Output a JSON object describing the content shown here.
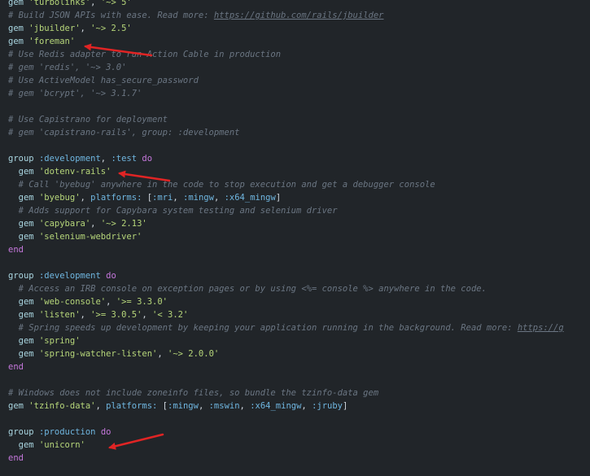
{
  "editor": {
    "lines": [
      [
        {
          "t": "gem",
          "c": "gem"
        },
        {
          "t": " ",
          "c": "plain"
        },
        {
          "t": "'turbolinks'",
          "c": "str"
        },
        {
          "t": ", ",
          "c": "plain"
        },
        {
          "t": "'~> 5'",
          "c": "str"
        }
      ],
      [
        {
          "t": "# Build JSON APIs with ease. Read more: ",
          "c": "cmt"
        },
        {
          "t": "https://github.com/rails/jbuilder",
          "c": "url"
        }
      ],
      [
        {
          "t": "gem",
          "c": "gem"
        },
        {
          "t": " ",
          "c": "plain"
        },
        {
          "t": "'jbuilder'",
          "c": "str"
        },
        {
          "t": ", ",
          "c": "plain"
        },
        {
          "t": "'~> 2.5'",
          "c": "str"
        }
      ],
      [
        {
          "t": "gem",
          "c": "gem"
        },
        {
          "t": " ",
          "c": "plain"
        },
        {
          "t": "'foreman'",
          "c": "str"
        }
      ],
      [
        {
          "t": "# Use Redis adapter to run Action Cable in production",
          "c": "cmt"
        }
      ],
      [
        {
          "t": "# gem 'redis', '~> 3.0'",
          "c": "cmt"
        }
      ],
      [
        {
          "t": "# Use ActiveModel has_secure_password",
          "c": "cmt"
        }
      ],
      [
        {
          "t": "# gem 'bcrypt', '~> 3.1.7'",
          "c": "cmt"
        }
      ],
      [],
      [
        {
          "t": "# Use Capistrano for deployment",
          "c": "cmt"
        }
      ],
      [
        {
          "t": "# gem 'capistrano-rails', group: :development",
          "c": "cmt"
        }
      ],
      [],
      [
        {
          "t": "group",
          "c": "gem"
        },
        {
          "t": " ",
          "c": "plain"
        },
        {
          "t": ":development",
          "c": "sym"
        },
        {
          "t": ", ",
          "c": "plain"
        },
        {
          "t": ":test",
          "c": "sym"
        },
        {
          "t": " ",
          "c": "plain"
        },
        {
          "t": "do",
          "c": "kw"
        }
      ],
      [
        {
          "t": "  gem",
          "c": "gem"
        },
        {
          "t": " ",
          "c": "plain"
        },
        {
          "t": "'dotenv-rails'",
          "c": "str"
        }
      ],
      [
        {
          "t": "  # Call 'byebug' anywhere in the code to stop execution and get a debugger console",
          "c": "cmt"
        }
      ],
      [
        {
          "t": "  gem",
          "c": "gem"
        },
        {
          "t": " ",
          "c": "plain"
        },
        {
          "t": "'byebug'",
          "c": "str"
        },
        {
          "t": ", ",
          "c": "plain"
        },
        {
          "t": "platforms:",
          "c": "sym"
        },
        {
          "t": " [",
          "c": "plain"
        },
        {
          "t": ":mri",
          "c": "sym"
        },
        {
          "t": ", ",
          "c": "plain"
        },
        {
          "t": ":mingw",
          "c": "sym"
        },
        {
          "t": ", ",
          "c": "plain"
        },
        {
          "t": ":x64_mingw",
          "c": "sym"
        },
        {
          "t": "]",
          "c": "plain"
        }
      ],
      [
        {
          "t": "  # Adds support for Capybara system testing and selenium driver",
          "c": "cmt"
        }
      ],
      [
        {
          "t": "  gem",
          "c": "gem"
        },
        {
          "t": " ",
          "c": "plain"
        },
        {
          "t": "'capybara'",
          "c": "str"
        },
        {
          "t": ", ",
          "c": "plain"
        },
        {
          "t": "'~> 2.13'",
          "c": "str"
        }
      ],
      [
        {
          "t": "  gem",
          "c": "gem"
        },
        {
          "t": " ",
          "c": "plain"
        },
        {
          "t": "'selenium-webdriver'",
          "c": "str"
        }
      ],
      [
        {
          "t": "end",
          "c": "kw"
        }
      ],
      [],
      [
        {
          "t": "group",
          "c": "gem"
        },
        {
          "t": " ",
          "c": "plain"
        },
        {
          "t": ":development",
          "c": "sym"
        },
        {
          "t": " ",
          "c": "plain"
        },
        {
          "t": "do",
          "c": "kw"
        }
      ],
      [
        {
          "t": "  # Access an IRB console on exception pages or by using <%= console %> anywhere in the code.",
          "c": "cmt"
        }
      ],
      [
        {
          "t": "  gem",
          "c": "gem"
        },
        {
          "t": " ",
          "c": "plain"
        },
        {
          "t": "'web-console'",
          "c": "str"
        },
        {
          "t": ", ",
          "c": "plain"
        },
        {
          "t": "'>= 3.3.0'",
          "c": "str"
        }
      ],
      [
        {
          "t": "  gem",
          "c": "gem"
        },
        {
          "t": " ",
          "c": "plain"
        },
        {
          "t": "'listen'",
          "c": "str"
        },
        {
          "t": ", ",
          "c": "plain"
        },
        {
          "t": "'>= 3.0.5'",
          "c": "str"
        },
        {
          "t": ", ",
          "c": "plain"
        },
        {
          "t": "'< 3.2'",
          "c": "str"
        }
      ],
      [
        {
          "t": "  # Spring speeds up development by keeping your application running in the background. Read more: ",
          "c": "cmt"
        },
        {
          "t": "https://g",
          "c": "url"
        }
      ],
      [
        {
          "t": "  gem",
          "c": "gem"
        },
        {
          "t": " ",
          "c": "plain"
        },
        {
          "t": "'spring'",
          "c": "str"
        }
      ],
      [
        {
          "t": "  gem",
          "c": "gem"
        },
        {
          "t": " ",
          "c": "plain"
        },
        {
          "t": "'spring-watcher-listen'",
          "c": "str"
        },
        {
          "t": ", ",
          "c": "plain"
        },
        {
          "t": "'~> 2.0.0'",
          "c": "str"
        }
      ],
      [
        {
          "t": "end",
          "c": "kw"
        }
      ],
      [],
      [
        {
          "t": "# Windows does not include zoneinfo files, so bundle the tzinfo-data gem",
          "c": "cmt"
        }
      ],
      [
        {
          "t": "gem",
          "c": "gem"
        },
        {
          "t": " ",
          "c": "plain"
        },
        {
          "t": "'tzinfo-data'",
          "c": "str"
        },
        {
          "t": ", ",
          "c": "plain"
        },
        {
          "t": "platforms:",
          "c": "sym"
        },
        {
          "t": " [",
          "c": "plain"
        },
        {
          "t": ":mingw",
          "c": "sym"
        },
        {
          "t": ", ",
          "c": "plain"
        },
        {
          "t": ":mswin",
          "c": "sym"
        },
        {
          "t": ", ",
          "c": "plain"
        },
        {
          "t": ":x64_mingw",
          "c": "sym"
        },
        {
          "t": ", ",
          "c": "plain"
        },
        {
          "t": ":jruby",
          "c": "sym"
        },
        {
          "t": "]",
          "c": "plain"
        }
      ],
      [],
      [
        {
          "t": "group",
          "c": "gem"
        },
        {
          "t": " ",
          "c": "plain"
        },
        {
          "t": ":production",
          "c": "sym"
        },
        {
          "t": " ",
          "c": "plain"
        },
        {
          "t": "do",
          "c": "kw"
        }
      ],
      [
        {
          "t": "  gem",
          "c": "gem"
        },
        {
          "t": " ",
          "c": "plain"
        },
        {
          "t": "'unicorn'",
          "c": "str"
        }
      ],
      [
        {
          "t": "end",
          "c": "kw"
        }
      ]
    ]
  },
  "annotations": {
    "arrow_color": "#e02424",
    "arrows": [
      {
        "points_to": "foreman"
      },
      {
        "points_to": "dotenv-rails"
      },
      {
        "points_to": "unicorn"
      }
    ]
  }
}
